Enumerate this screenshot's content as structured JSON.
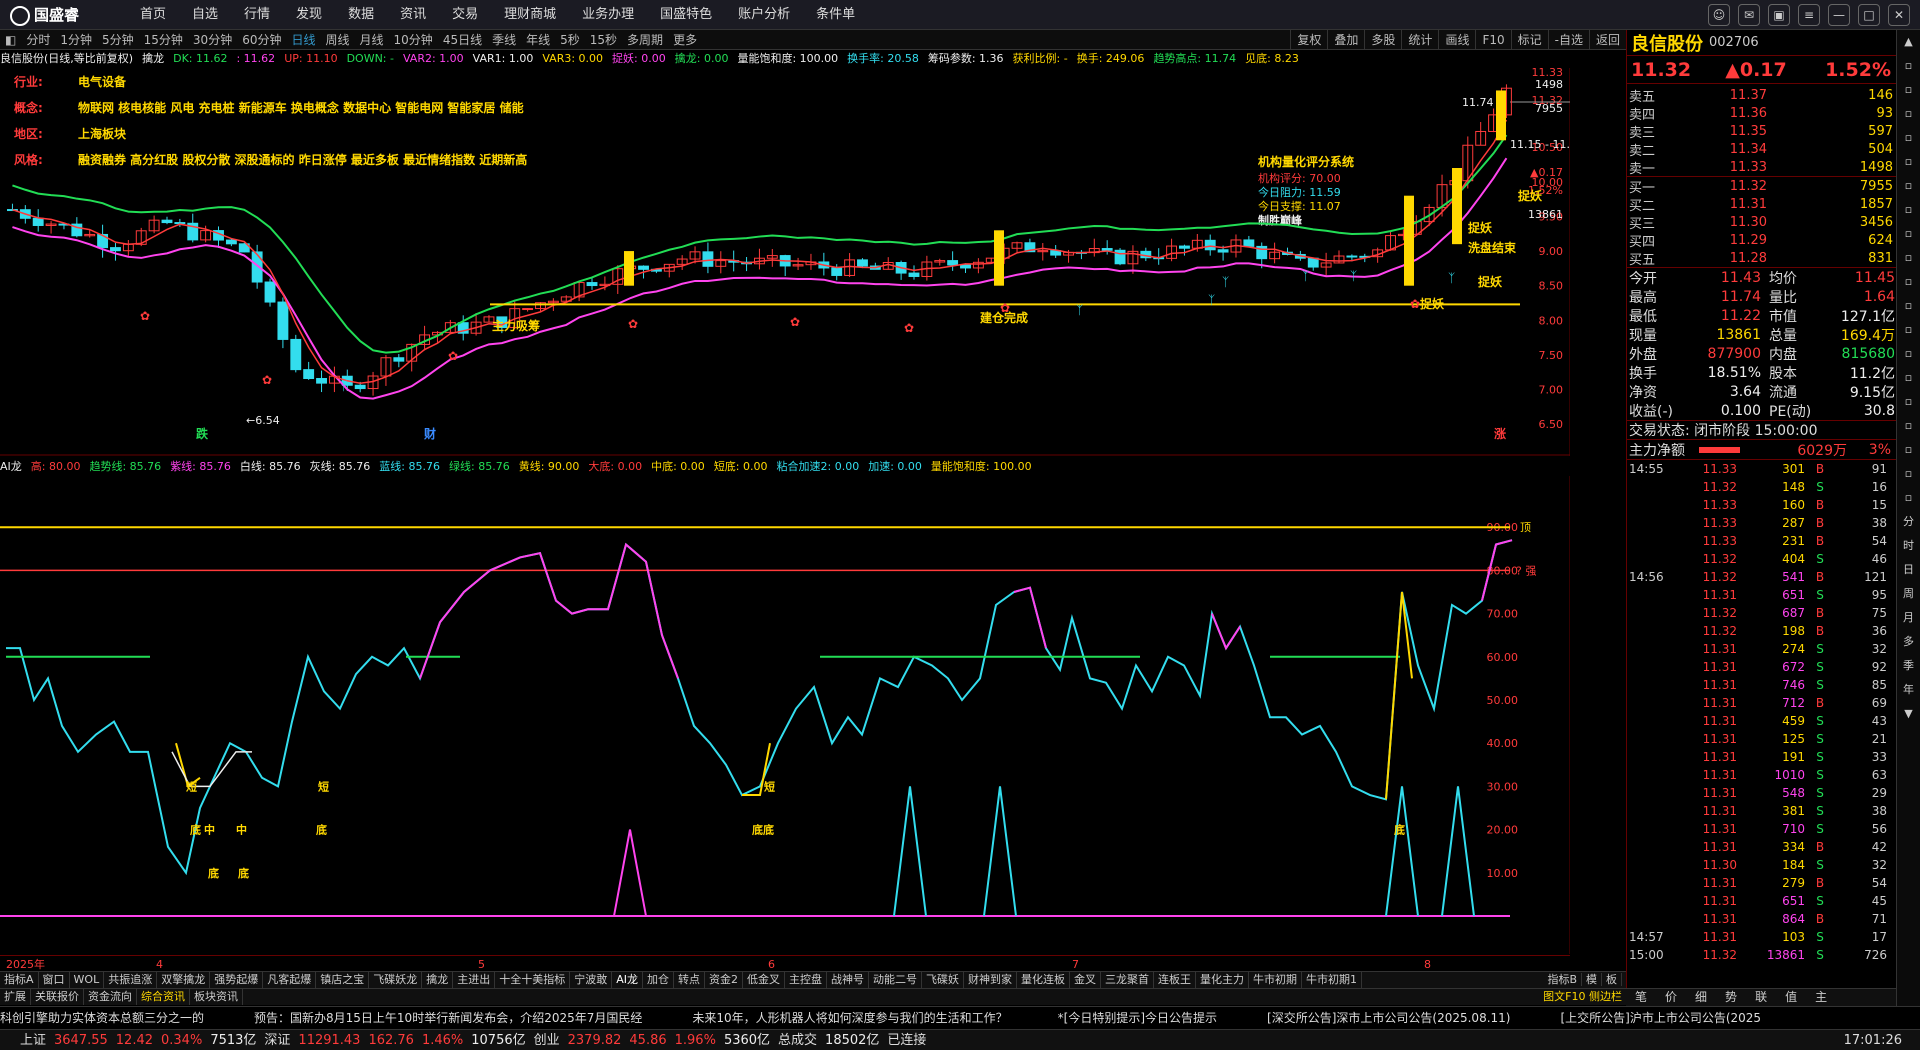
{
  "app": {
    "logo": "国盛睿"
  },
  "nav": [
    "首页",
    "自选",
    "行情",
    "发现",
    "数据",
    "资讯",
    "交易",
    "理财商城",
    "业务办理",
    "国盛特色",
    "账户分析",
    "条件单"
  ],
  "periods": [
    "分时",
    "1分钟",
    "5分钟",
    "15分钟",
    "30分钟",
    "60分钟",
    "日线",
    "周线",
    "月线",
    "10分钟",
    "45日线",
    "季线",
    "年线",
    "5秒",
    "15秒",
    "多周期",
    "更多"
  ],
  "active_period": "日线",
  "chart_tools": [
    "复权",
    "叠加",
    "多股",
    "统计",
    "画线",
    "F10",
    "标记",
    "-自选",
    "返回"
  ],
  "indicator_line": [
    {
      "t": "良信股份(日线,等比前复权)",
      "c": "w"
    },
    {
      "t": "擒龙",
      "c": "w"
    },
    {
      "t": "DK: 11.62",
      "c": "g"
    },
    {
      "t": ": 11.62",
      "c": "m"
    },
    {
      "t": "UP: 11.10",
      "c": "r"
    },
    {
      "t": "DOWN: -",
      "c": "g"
    },
    {
      "t": "VAR2: 1.00",
      "c": "m"
    },
    {
      "t": "VAR1: 1.00",
      "c": "w"
    },
    {
      "t": "VAR3: 0.00",
      "c": "y"
    },
    {
      "t": "捉妖: 0.00",
      "c": "m"
    },
    {
      "t": "擒龙: 0.00",
      "c": "g"
    },
    {
      "t": "量能饱和度: 100.00",
      "c": "w"
    },
    {
      "t": "换手率: 20.58",
      "c": "c"
    },
    {
      "t": "筹码参数: 1.36",
      "c": "w"
    },
    {
      "t": "获利比例: -",
      "c": "y"
    },
    {
      "t": "换手: 249.06",
      "c": "y"
    },
    {
      "t": "趋势高点: 11.74",
      "c": "g"
    },
    {
      "t": "见底: 8.23",
      "c": "y"
    }
  ],
  "info_rows": [
    {
      "k": "行业:",
      "v": "电气设备"
    },
    {
      "k": "概念:",
      "v": "物联网 核电核能 风电 充电桩 新能源车 换电概念 数据中心 智能电网 智能家居 储能"
    },
    {
      "k": "地区:",
      "v": "上海板块"
    },
    {
      "k": "风格:",
      "v": "融资融券 高分红股 股权分散 深股通标的 昨日涨停 最近多板 最近情绪指数 近期新高"
    }
  ],
  "inst_panel": {
    "title": "机构量化评分系统",
    "score": "机构评分: 70.00",
    "res": "今日阻力: 11.59",
    "sup": "今日支撑: 11.07",
    "tag": "制胜巅峰"
  },
  "main_y_labels": [
    "11.33",
    "11.32",
    "10.50",
    "10.00",
    "9.50",
    "9.00",
    "8.50",
    "8.00",
    "7.50",
    "7.00",
    "6.50"
  ],
  "main_right_tags": [
    "1498",
    "7955",
    "▲0.17",
    "1.52%",
    "13861"
  ],
  "price_marks": {
    "high": "11.74",
    "low": "6.54",
    "range": "11.15 - 11.2"
  },
  "annotations": [
    "主力吸筹",
    "建仓完成",
    "洗盘结束",
    "捉妖",
    "捉妖",
    "捉妖",
    "捉妖",
    "跌",
    "财",
    "涨"
  ],
  "sub_indicator_line": [
    {
      "t": "AI龙",
      "c": "w"
    },
    {
      "t": "高: 80.00",
      "c": "r"
    },
    {
      "t": "趋势线: 85.76",
      "c": "g"
    },
    {
      "t": "紫线: 85.76",
      "c": "m"
    },
    {
      "t": "白线: 85.76",
      "c": "w"
    },
    {
      "t": "灰线: 85.76",
      "c": "w"
    },
    {
      "t": "蓝线: 85.76",
      "c": "c"
    },
    {
      "t": "绿线: 85.76",
      "c": "g"
    },
    {
      "t": "黄线: 90.00",
      "c": "y"
    },
    {
      "t": "大底: 0.00",
      "c": "r"
    },
    {
      "t": "中底: 0.00",
      "c": "y"
    },
    {
      "t": "短底: 0.00",
      "c": "y"
    },
    {
      "t": "粘合加速2: 0.00",
      "c": "c"
    },
    {
      "t": "加速: 0.00",
      "c": "c"
    },
    {
      "t": "量能饱和度: 100.00",
      "c": "y"
    }
  ],
  "sub_y_labels": [
    "90.00",
    "80.00",
    "70.00",
    "60.00",
    "50.00",
    "40.00",
    "30.00",
    "20.00",
    "10.00"
  ],
  "sub_tags": [
    "顶",
    "强"
  ],
  "sub_text_marks": [
    "短",
    "底",
    "中",
    "中",
    "底",
    "底",
    "底",
    "短",
    "底底",
    "短",
    "底"
  ],
  "x_labels": [
    "2025年",
    "4",
    "5",
    "6",
    "7",
    "8"
  ],
  "x_right": "日线",
  "tabs1": [
    "指标A",
    "窗口",
    "WOL",
    "共振追涨",
    "双擎擒龙",
    "强势起爆",
    "凡客起爆",
    "镇店之宝",
    "飞碟妖龙",
    "擒龙",
    "主进出",
    "十全十美指标",
    "宁波敢",
    "AI龙",
    "加仓",
    "转点",
    "资金2",
    "低金叉",
    "主控盘",
    "战神号",
    "动能二号",
    "飞碟妖",
    "财神到家",
    "量化连板",
    "金叉",
    "三龙聚首",
    "连板王",
    "量化主力",
    "牛市初期",
    "牛市初期1"
  ],
  "tabs1_right": [
    "指标B",
    "模",
    "板"
  ],
  "tabs2": [
    "扩展",
    "关联报价",
    "资金流向",
    "综合资讯",
    "板块资讯"
  ],
  "tabs2_right": "图文F10 侧边栏",
  "ticker": [
    "科创引擎助力实体资本总额三分之一的",
    "预告：国新办8月15日上午10时举行新闻发布会，介绍2025年7月国民经",
    "未来10年，人形机器人将如何深度参与我们的生活和工作？",
    "*[今日特别提示]今日公告提示",
    "[深交所公告]深市上市公司公告(2025.08.11)",
    "[上交所公告]沪市上市公司公告(2025"
  ],
  "status": {
    "sh": "上证",
    "sh_idx": "3647.55",
    "sh_chg": "12.42",
    "sh_pct": "0.34%",
    "sh_amt": "7513亿",
    "sz": "深证",
    "sz_idx": "11291.43",
    "sz_chg": "162.76",
    "sz_pct": "1.46%",
    "sz_amt": "10756亿",
    "cy": "创业",
    "cy_idx": "2379.82",
    "cy_chg": "45.86",
    "cy_pct": "1.96%",
    "cy_amt": "5360亿",
    "total": "总成交",
    "total_amt": "18502亿",
    "conn": "已连接",
    "time": "17:01:26"
  },
  "stock": {
    "name": "良信股份",
    "code": "002706",
    "price": "11.32",
    "chg": "▲0.17",
    "pct": "1.52%"
  },
  "sells": [
    {
      "l": "卖五",
      "p": "11.37",
      "v": "146"
    },
    {
      "l": "卖四",
      "p": "11.36",
      "v": "93"
    },
    {
      "l": "卖三",
      "p": "11.35",
      "v": "597"
    },
    {
      "l": "卖二",
      "p": "11.34",
      "v": "504"
    },
    {
      "l": "卖一",
      "p": "11.33",
      "v": "1498"
    }
  ],
  "buys": [
    {
      "l": "买一",
      "p": "11.32",
      "v": "7955"
    },
    {
      "l": "买二",
      "p": "11.31",
      "v": "1857"
    },
    {
      "l": "买三",
      "p": "11.30",
      "v": "3456"
    },
    {
      "l": "买四",
      "p": "11.29",
      "v": "624"
    },
    {
      "l": "买五",
      "p": "11.28",
      "v": "831"
    }
  ],
  "quote": [
    {
      "k": "今开",
      "v": "11.43",
      "vc": "r",
      "k2": "均价",
      "v2": "11.45",
      "v2c": "r"
    },
    {
      "k": "最高",
      "v": "11.74",
      "vc": "r",
      "k2": "量比",
      "v2": "1.64",
      "v2c": "r"
    },
    {
      "k": "最低",
      "v": "11.22",
      "vc": "r",
      "k2": "市值",
      "v2": "127.1亿",
      "v2c": "w"
    },
    {
      "k": "现量",
      "v": "13861",
      "vc": "y",
      "k2": "总量",
      "v2": "169.4万",
      "v2c": "y"
    },
    {
      "k": "外盘",
      "v": "877900",
      "vc": "r",
      "k2": "内盘",
      "v2": "815680",
      "v2c": "g"
    },
    {
      "k": "换手",
      "v": "18.51%",
      "vc": "w",
      "k2": "股本",
      "v2": "11.2亿",
      "v2c": "w"
    },
    {
      "k": "净资",
      "v": "3.64",
      "vc": "w",
      "k2": "流通",
      "v2": "9.15亿",
      "v2c": "w"
    },
    {
      "k": "收益(-)",
      "v": "0.100",
      "vc": "w",
      "k2": "PE(动)",
      "v2": "30.8",
      "v2c": "w"
    }
  ],
  "trade_state": "交易状态: 闭市阶段 15:00:00",
  "main_money": {
    "label": "主力净额",
    "value": "6029万",
    "pct": "3%",
    "level": 0.53
  },
  "ticks": [
    {
      "t": "14:55",
      "p": "11.33",
      "v": "301",
      "bs": "B",
      "n": "91"
    },
    {
      "t": "",
      "p": "11.32",
      "v": "148",
      "bs": "S",
      "n": "16"
    },
    {
      "t": "",
      "p": "11.33",
      "v": "160",
      "bs": "B",
      "n": "15"
    },
    {
      "t": "",
      "p": "11.33",
      "v": "287",
      "bs": "B",
      "n": "38"
    },
    {
      "t": "",
      "p": "11.33",
      "v": "231",
      "bs": "B",
      "n": "54"
    },
    {
      "t": "",
      "p": "11.32",
      "v": "404",
      "bs": "S",
      "n": "46"
    },
    {
      "t": "14:56",
      "p": "11.32",
      "v": "541",
      "bs": "B",
      "n": "121"
    },
    {
      "t": "",
      "p": "11.31",
      "v": "651",
      "bs": "S",
      "n": "95"
    },
    {
      "t": "",
      "p": "11.32",
      "v": "687",
      "bs": "B",
      "n": "75"
    },
    {
      "t": "",
      "p": "11.32",
      "v": "198",
      "bs": "B",
      "n": "36"
    },
    {
      "t": "",
      "p": "11.31",
      "v": "274",
      "bs": "S",
      "n": "32"
    },
    {
      "t": "",
      "p": "11.31",
      "v": "672",
      "bs": "S",
      "n": "92"
    },
    {
      "t": "",
      "p": "11.31",
      "v": "746",
      "bs": "S",
      "n": "85"
    },
    {
      "t": "",
      "p": "11.31",
      "v": "712",
      "bs": "B",
      "n": "69"
    },
    {
      "t": "",
      "p": "11.31",
      "v": "459",
      "bs": "S",
      "n": "43"
    },
    {
      "t": "",
      "p": "11.31",
      "v": "125",
      "bs": "S",
      "n": "21"
    },
    {
      "t": "",
      "p": "11.31",
      "v": "191",
      "bs": "S",
      "n": "33"
    },
    {
      "t": "",
      "p": "11.31",
      "v": "1010",
      "bs": "S",
      "n": "63"
    },
    {
      "t": "",
      "p": "11.31",
      "v": "548",
      "bs": "S",
      "n": "29"
    },
    {
      "t": "",
      "p": "11.31",
      "v": "381",
      "bs": "S",
      "n": "38"
    },
    {
      "t": "",
      "p": "11.31",
      "v": "710",
      "bs": "S",
      "n": "56"
    },
    {
      "t": "",
      "p": "11.31",
      "v": "334",
      "bs": "B",
      "n": "42"
    },
    {
      "t": "",
      "p": "11.30",
      "v": "184",
      "bs": "S",
      "n": "32"
    },
    {
      "t": "",
      "p": "11.31",
      "v": "279",
      "bs": "B",
      "n": "54"
    },
    {
      "t": "",
      "p": "11.31",
      "v": "651",
      "bs": "S",
      "n": "45"
    },
    {
      "t": "",
      "p": "11.31",
      "v": "864",
      "bs": "B",
      "n": "71"
    },
    {
      "t": "14:57",
      "p": "11.31",
      "v": "103",
      "bs": "S",
      "n": "17"
    },
    {
      "t": "15:00",
      "p": "11.32",
      "v": "13861",
      "bs": "S",
      "n": "726"
    }
  ],
  "right_bottom": [
    "笔",
    "价",
    "细",
    "势",
    "联",
    "值",
    "主"
  ],
  "vside": [
    "▲",
    "",
    "",
    "",
    "",
    "",
    "",
    "",
    "",
    "",
    "",
    "",
    "",
    "",
    "",
    "",
    "",
    "",
    "",
    "",
    "分",
    "时",
    "日",
    "周",
    "月",
    "多",
    "季",
    "年",
    "▼"
  ]
}
